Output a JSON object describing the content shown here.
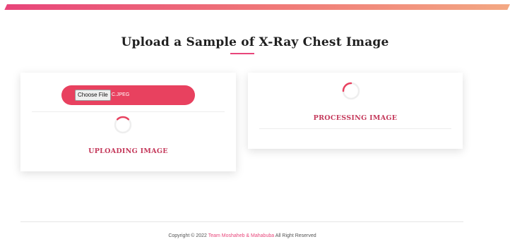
{
  "header": {
    "title": "Upload a Sample of X-Ray Chest Image",
    "accent_color": "#e8457a"
  },
  "upload_card": {
    "choose_file_label": "Choose File",
    "selected_file": "C.JPEG",
    "status": "UPLOADING IMAGE",
    "spinner_icon": "loading-spinner-icon"
  },
  "processing_card": {
    "status": "PROCESSING IMAGE",
    "spinner_icon": "loading-spinner-icon"
  },
  "footer": {
    "prefix": "Copyright © 2022",
    "team": "Team Moshaheb & Mahabuba",
    "suffix": "All Right Reserved"
  }
}
